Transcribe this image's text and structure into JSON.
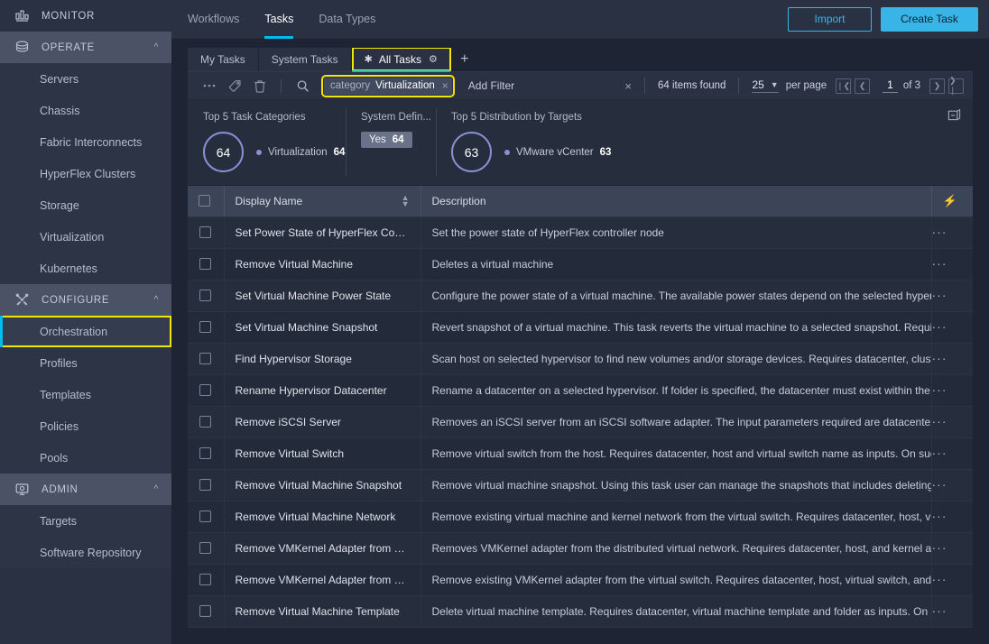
{
  "sidebar": {
    "groups": [
      {
        "label": "MONITOR",
        "icon": "bar-chart-icon",
        "collapsible": false,
        "expanded": false,
        "items": []
      },
      {
        "label": "OPERATE",
        "icon": "layers-icon",
        "collapsible": true,
        "expanded": true,
        "items": [
          {
            "label": "Servers"
          },
          {
            "label": "Chassis"
          },
          {
            "label": "Fabric Interconnects"
          },
          {
            "label": "HyperFlex Clusters"
          },
          {
            "label": "Storage"
          },
          {
            "label": "Virtualization"
          },
          {
            "label": "Kubernetes"
          }
        ]
      },
      {
        "label": "CONFIGURE",
        "icon": "tools-icon",
        "collapsible": true,
        "expanded": true,
        "items": [
          {
            "label": "Orchestration",
            "active": true,
            "highlighted": true
          },
          {
            "label": "Profiles"
          },
          {
            "label": "Templates"
          },
          {
            "label": "Policies"
          },
          {
            "label": "Pools"
          }
        ]
      },
      {
        "label": "ADMIN",
        "icon": "monitor-gear-icon",
        "collapsible": true,
        "expanded": true,
        "items": [
          {
            "label": "Targets"
          },
          {
            "label": "Software Repository"
          }
        ]
      }
    ]
  },
  "topbar": {
    "tabs": [
      {
        "label": "Workflows",
        "active": false
      },
      {
        "label": "Tasks",
        "active": true
      },
      {
        "label": "Data Types",
        "active": false
      }
    ],
    "import_label": "Import",
    "create_label": "Create Task"
  },
  "viewtabs": {
    "tabs": [
      {
        "label": "My Tasks",
        "selected": false
      },
      {
        "label": "System Tasks",
        "selected": false
      },
      {
        "label": "All Tasks",
        "selected": true,
        "star_icon": "asterisk-icon",
        "gear_icon": "gear-icon"
      }
    ],
    "add_label": "+"
  },
  "toolbar": {
    "icons": [
      "more-options-icon",
      "tag-icon",
      "trash-icon",
      "search-icon"
    ],
    "filter_chip": {
      "key": "category",
      "value": "Virtualization",
      "remove": "×"
    },
    "add_filter_label": "Add Filter",
    "clear_label": "×",
    "items_found": "64 items found",
    "page_size": "25",
    "per_page_label": "per page",
    "page_current": "1",
    "page_of": "of 3",
    "nav_first": "❘❮",
    "nav_prev": "❮",
    "nav_next": "❯",
    "nav_last": "❯❘"
  },
  "summary": {
    "collapse_icon": "collapse-panel-icon",
    "cards": [
      {
        "title": "Top 5 Task Categories",
        "kind": "donut",
        "total": "64",
        "legend": [
          {
            "name": "Virtualization",
            "value": "64",
            "color": "#8b8fd4"
          }
        ]
      },
      {
        "title": "System Defin...",
        "kind": "pill",
        "pill": {
          "key": "Yes",
          "value": "64"
        }
      },
      {
        "title": "Top 5 Distribution by Targets",
        "kind": "donut",
        "total": "63",
        "legend": [
          {
            "name": "VMware vCenter",
            "value": "63",
            "color": "#8b8fd4"
          }
        ]
      }
    ]
  },
  "chart_data": [
    {
      "type": "pie",
      "title": "Top 5 Task Categories",
      "categories": [
        "Virtualization"
      ],
      "values": [
        64
      ],
      "total": 64,
      "legend_position": "right",
      "colors": [
        "#8b8fd4"
      ]
    },
    {
      "type": "bar",
      "title": "System Defin...",
      "categories": [
        "Yes"
      ],
      "values": [
        64
      ],
      "total": 64,
      "xlabel": "",
      "ylabel": ""
    },
    {
      "type": "pie",
      "title": "Top 5 Distribution by Targets",
      "categories": [
        "VMware vCenter"
      ],
      "values": [
        63
      ],
      "total": 63,
      "legend_position": "right",
      "colors": [
        "#8b8fd4"
      ]
    }
  ],
  "table": {
    "columns": [
      {
        "key": "display_name",
        "label": "Display Name",
        "sortable": true
      },
      {
        "key": "description",
        "label": "Description",
        "sortable": false
      }
    ],
    "action_header_icon": "lightning-bolt-icon",
    "rows": [
      {
        "display_name": "Set Power State of HyperFlex Controller N...",
        "description": "Set the power state of HyperFlex controller node"
      },
      {
        "display_name": "Remove Virtual Machine",
        "description": "Deletes a virtual machine"
      },
      {
        "display_name": "Set Virtual Machine Power State",
        "description": "Configure the power state of a virtual machine. The available power states depend on the selected hypervisor platform."
      },
      {
        "display_name": "Set Virtual Machine Snapshot",
        "description": "Revert snapshot of a virtual machine. This task reverts the virtual machine to a selected snapshot. Requires datacenter, virtual"
      },
      {
        "display_name": "Find Hypervisor Storage",
        "description": "Scan host on selected hypervisor to find new volumes and/or storage devices. Requires datacenter, cluster (or host) as inputs."
      },
      {
        "display_name": "Rename Hypervisor Datacenter",
        "description": "Rename a datacenter on a selected hypervisor. If folder is specified, the datacenter must exist within the folder. On successful"
      },
      {
        "display_name": "Remove iSCSI Server",
        "description": "Removes an iSCSI server from an iSCSI software adapter. The input parameters required are datacenter, host, iSCSI software a"
      },
      {
        "display_name": "Remove Virtual Switch",
        "description": "Remove virtual switch from the host. Requires datacenter, host and virtual switch name as inputs. On successful execution, da"
      },
      {
        "display_name": "Remove Virtual Machine Snapshot",
        "description": "Remove virtual machine snapshot. Using this task user can manage the snapshots that includes deleting a single snapshot of"
      },
      {
        "display_name": "Remove Virtual Machine Network",
        "description": "Remove existing virtual machine and kernel network from the virtual switch. Requires datacenter, host, virtual switch, and virtu"
      },
      {
        "display_name": "Remove VMKernel Adapter from Distribut...",
        "description": "Removes VMKernel adapter from the distributed virtual network. Requires datacenter, host, and kernel adapter as mandatory in"
      },
      {
        "display_name": "Remove VMKernel Adapter from Virtual S...",
        "description": "Remove existing VMKernel adapter from the virtual switch. Requires datacenter, host, virtual switch, and virtual machine netwo"
      },
      {
        "display_name": "Remove Virtual Machine Template",
        "description": "Delete virtual machine template. Requires datacenter, virtual machine template and folder as inputs. On successful execution, "
      }
    ],
    "row_action_label": "···"
  },
  "colors": {
    "accent": "#00bceb",
    "primary_button": "#38b5e6",
    "highlight_outline": "#f2e500",
    "chart_purple": "#8b8fd4",
    "sidebar_bg": "#2a3142",
    "page_bg": "#1e2433"
  }
}
